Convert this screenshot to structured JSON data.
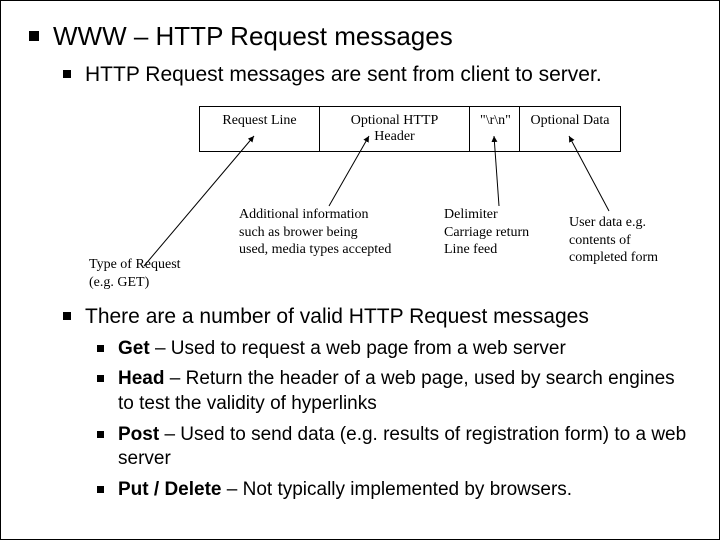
{
  "title": "WWW – HTTP Request messages",
  "sub1": "HTTP Request messages are sent from client to server.",
  "diagram": {
    "cells": {
      "c1": "Request Line",
      "c2": "Optional HTTP Header",
      "c3": "\"\\r\\n\"",
      "c4": "Optional Data"
    },
    "ann_type": "Type of Request\n(e.g. GET)",
    "ann_add": "Additional information\nsuch as brower being\nused, media types accepted",
    "ann_delim": "Delimiter\nCarriage return\nLine feed",
    "ann_user": "User data e.g.\ncontents of\ncompleted form"
  },
  "sub2": "There are a number of valid HTTP Request messages",
  "items": [
    {
      "term": "Get",
      "desc": " – Used to request a web page from a web server"
    },
    {
      "term": "Head",
      "desc": " – Return the header of a web page, used by search engines to test the validity of hyperlinks"
    },
    {
      "term": "Post",
      "desc": " – Used to send data (e.g. results of registration form) to a web server"
    },
    {
      "term": "Put / Delete",
      "desc": " – Not typically implemented by browsers."
    }
  ]
}
